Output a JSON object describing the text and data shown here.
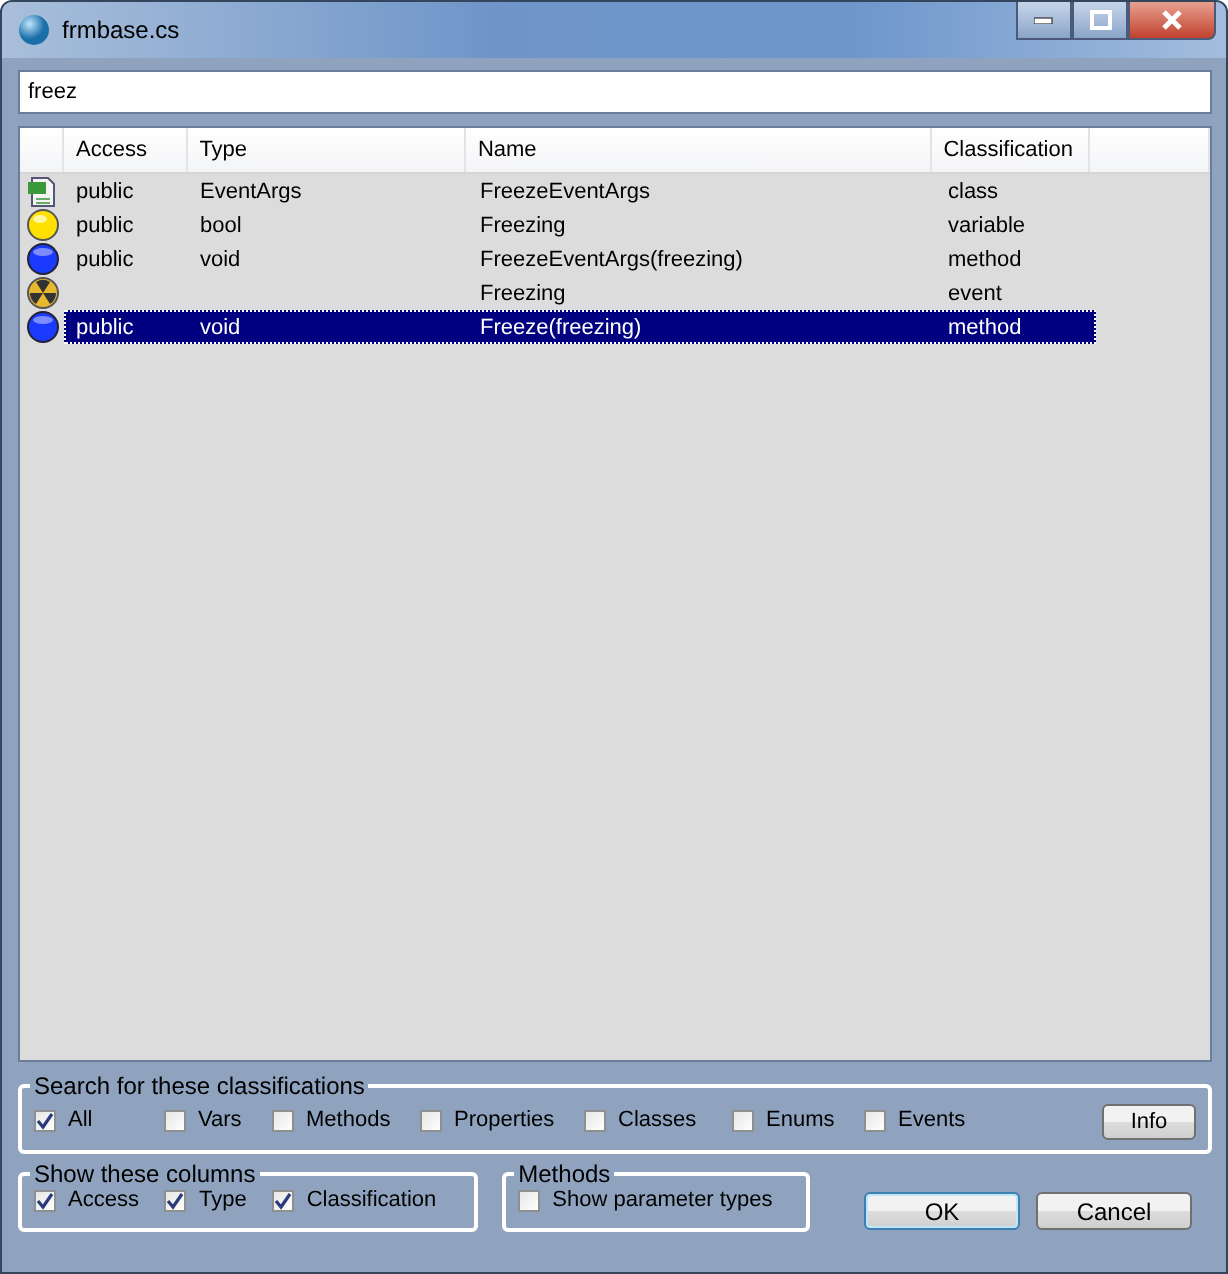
{
  "window": {
    "title": "frmbase.cs"
  },
  "search": {
    "value": "freez"
  },
  "table": {
    "columns": [
      "Access",
      "Type",
      "Name",
      "Classification"
    ],
    "rows": [
      {
        "kind": "class",
        "selected": false,
        "cells": [
          "public",
          "EventArgs",
          "FreezeEventArgs",
          "class"
        ]
      },
      {
        "kind": "variable",
        "selected": false,
        "cells": [
          "public",
          "bool",
          "Freezing",
          "variable"
        ]
      },
      {
        "kind": "method",
        "selected": false,
        "cells": [
          "public",
          "void",
          "FreezeEventArgs(freezing)",
          "method"
        ]
      },
      {
        "kind": "event",
        "selected": false,
        "cells": [
          "",
          "",
          "Freezing",
          "event"
        ]
      },
      {
        "kind": "method",
        "selected": true,
        "cells": [
          "public",
          "void",
          "Freeze(freezing)",
          "method"
        ]
      }
    ]
  },
  "classifications": {
    "title": "Search for these classifications",
    "options": [
      {
        "label": "All",
        "checked": true
      },
      {
        "label": "Vars",
        "checked": false
      },
      {
        "label": "Methods",
        "checked": false
      },
      {
        "label": "Properties",
        "checked": false
      },
      {
        "label": "Classes",
        "checked": false
      },
      {
        "label": "Enums",
        "checked": false
      },
      {
        "label": "Events",
        "checked": false
      }
    ],
    "button": "Info"
  },
  "columns_group": {
    "title": "Show these columns",
    "options": [
      {
        "label": "Access",
        "checked": true
      },
      {
        "label": "Type",
        "checked": true
      },
      {
        "label": "Classification",
        "checked": true
      }
    ]
  },
  "methods_group": {
    "title": "Methods",
    "options": [
      {
        "label": "Show parameter types",
        "checked": false
      }
    ]
  },
  "buttons": [
    "OK",
    "Cancel"
  ]
}
